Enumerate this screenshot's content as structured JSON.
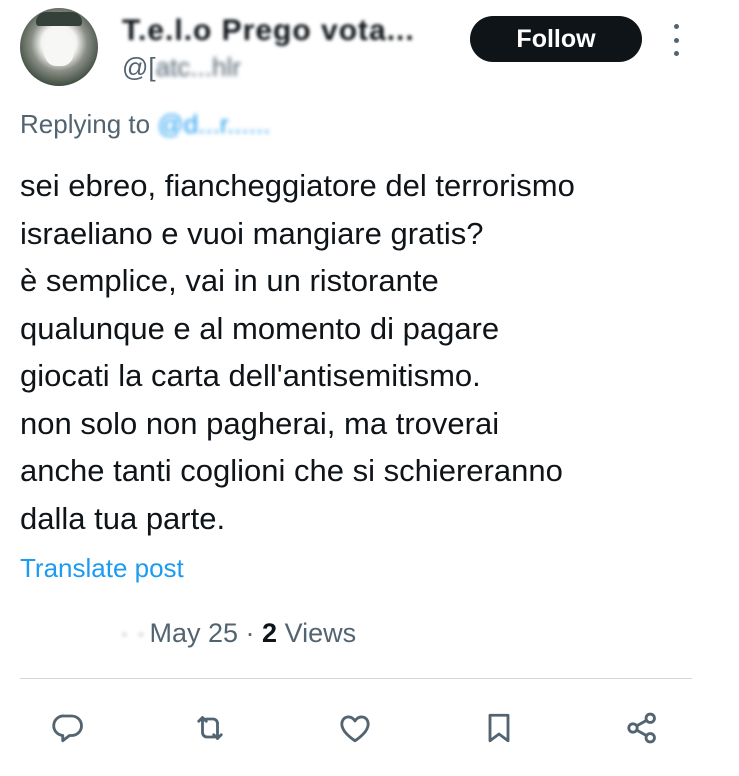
{
  "author": {
    "display_name": "T.e.l.o Prego vota...",
    "handle_prefix": "@[",
    "handle_rest": "atc...hlr"
  },
  "follow_label": "Follow",
  "reply": {
    "prefix": "Replying to ",
    "mention": "@d...r......"
  },
  "tweet": {
    "text": "sei ebreo, fiancheggiatore del terrorismo\nisraeliano e vuoi mangiare gratis?\nè semplice, vai in un ristorante\nqualunque e al momento di pagare\ngiocati la carta dell'antisemitismo.\nnon solo non pagherai, ma troverai\nanche tanti coglioni che si schiereranno\ndalla tua parte."
  },
  "translate_label": "Translate post",
  "meta": {
    "time": "·  ·",
    "date": "May 25",
    "separator": " · ",
    "views_count": "2",
    "views_label": " Views"
  },
  "actions": {
    "reply_icon": "reply-icon",
    "retweet_icon": "retweet-icon",
    "like_icon": "like-icon",
    "bookmark_icon": "bookmark-icon",
    "share_icon": "share-icon"
  },
  "colors": {
    "text": "#0f1419",
    "secondary": "#536471",
    "accent": "#1d9bf0",
    "follow_bg": "#0f1419"
  }
}
